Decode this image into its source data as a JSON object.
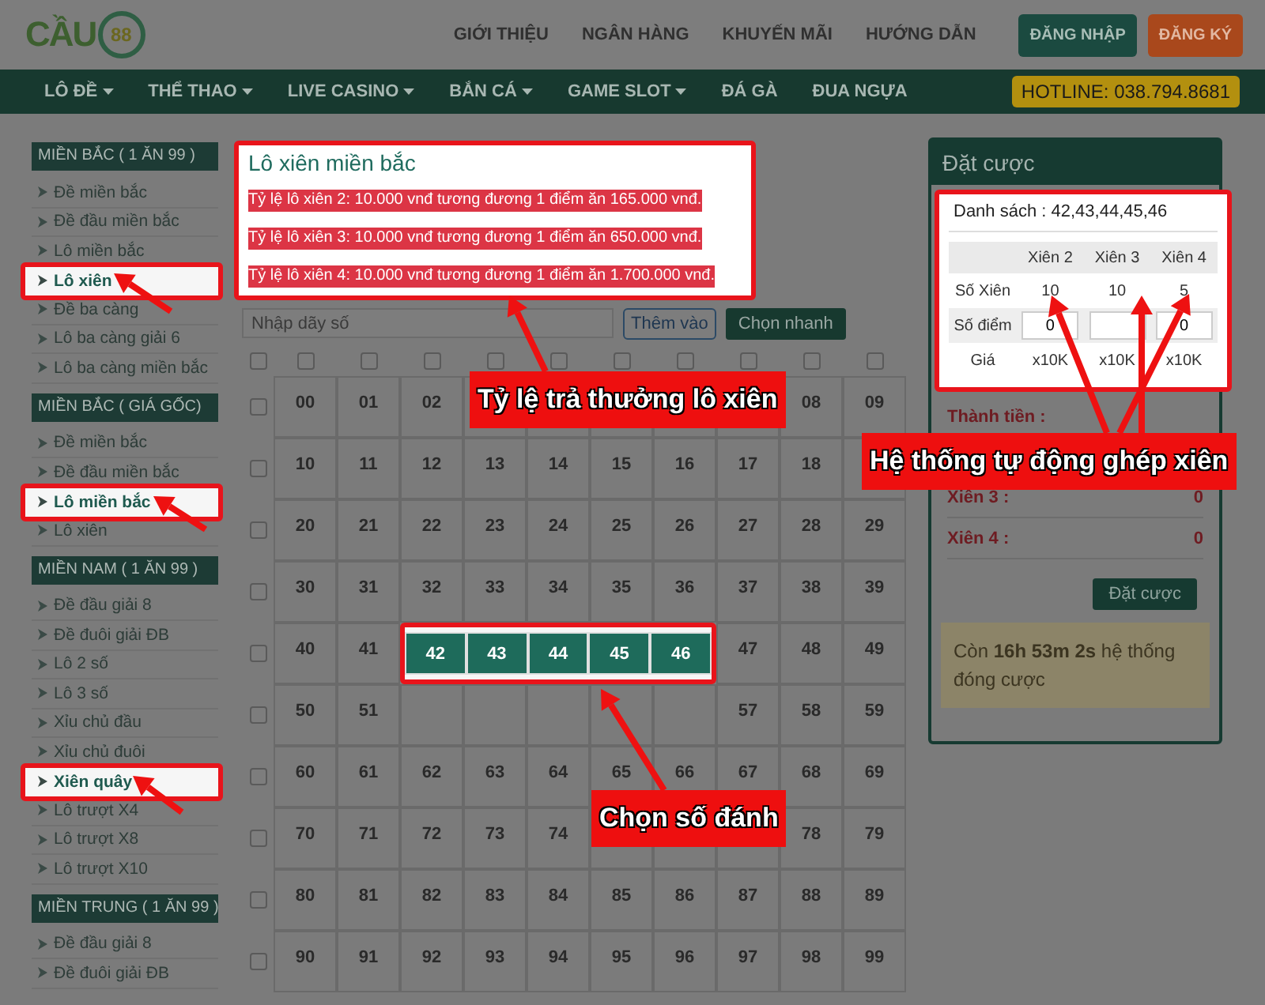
{
  "logo": {
    "text": "CẦU",
    "badge": "88"
  },
  "top_links": [
    "GIỚI THIỆU",
    "NGÂN HÀNG",
    "KHUYẾN MÃI",
    "HƯỚNG DẪN"
  ],
  "auth_buttons": [
    {
      "label": "ĐĂNG NHẬP",
      "kind": "login"
    },
    {
      "label": "ĐĂNG KÝ",
      "kind": "signup"
    }
  ],
  "nav": [
    {
      "label": "LÔ ĐỀ",
      "dropdown": true
    },
    {
      "label": "THỂ THAO",
      "dropdown": true
    },
    {
      "label": "LIVE CASINO",
      "dropdown": true
    },
    {
      "label": "BẮN CÁ",
      "dropdown": true
    },
    {
      "label": "GAME SLOT",
      "dropdown": true
    },
    {
      "label": "ĐÁ GÀ",
      "dropdown": false
    },
    {
      "label": "ĐUA NGỰA",
      "dropdown": false
    }
  ],
  "hotline": "HOTLINE: 038.794.8681",
  "sidebar": [
    {
      "title": "MIỀN BẮC ( 1 ĂN 99 )",
      "items": [
        {
          "label": "Đề miền bắc",
          "highlighted": false
        },
        {
          "label": "Đề đầu miền bắc",
          "highlighted": false
        },
        {
          "label": "Lô miền bắc",
          "highlighted": false
        },
        {
          "label": "Lô xiên",
          "highlighted": true
        },
        {
          "label": "Đề ba càng",
          "highlighted": false
        },
        {
          "label": "Lô ba càng giải 6",
          "highlighted": false
        },
        {
          "label": "Lô ba càng miền bắc",
          "highlighted": false
        }
      ]
    },
    {
      "title": "MIỀN BẮC ( GIÁ GỐC)",
      "items": [
        {
          "label": "Đề miền bắc",
          "highlighted": false
        },
        {
          "label": "Đề đầu miền bắc",
          "highlighted": false
        },
        {
          "label": "Lô miền bắc",
          "highlighted": true
        },
        {
          "label": "Lô xiên",
          "highlighted": false
        }
      ]
    },
    {
      "title": "MIỀN NAM ( 1 ĂN 99 )",
      "items": [
        {
          "label": "Đề đầu giải 8",
          "highlighted": false
        },
        {
          "label": "Đề đuôi giải ĐB",
          "highlighted": false
        },
        {
          "label": "Lô 2 số",
          "highlighted": false
        },
        {
          "label": "Lô 3 số",
          "highlighted": false
        },
        {
          "label": "Xỉu chủ đầu",
          "highlighted": false
        },
        {
          "label": "Xỉu chủ đuôi",
          "highlighted": false
        },
        {
          "label": "Xiên quây",
          "highlighted": true
        },
        {
          "label": "Lô trượt X4",
          "highlighted": false
        },
        {
          "label": "Lô trượt X8",
          "highlighted": false
        },
        {
          "label": "Lô trượt X10",
          "highlighted": false
        }
      ]
    },
    {
      "title": "MIỀN TRUNG ( 1 ĂN 99 )",
      "items": [
        {
          "label": "Đề đầu giải 8",
          "highlighted": false
        },
        {
          "label": "Đề đuôi giải ĐB",
          "highlighted": false
        }
      ]
    }
  ],
  "rates": {
    "title": "Lô xiên miền bắc",
    "lines": [
      "Tỷ lệ lô xiên 2: 10.000 vnđ tương đương 1 điểm ăn 165.000 vnđ.",
      "Tỷ lệ lô xiên 3: 10.000 vnđ tương đương 1 điểm ăn 650.000 vnđ.",
      "Tỷ lệ lô xiên 4: 10.000 vnđ tương đương 1 điểm ăn 1.700.000 vnđ."
    ]
  },
  "number_input": {
    "placeholder": "Nhập dãy số"
  },
  "add_button": "Thêm vào",
  "quick_button": "Chọn nhanh",
  "grid": {
    "column_checks": [
      {
        "checked": false
      },
      {
        "checked": false
      },
      {
        "checked": false
      },
      {
        "checked": false
      },
      {
        "checked": false
      },
      {
        "checked": false
      },
      {
        "checked": false
      },
      {
        "checked": false
      },
      {
        "checked": false
      },
      {
        "checked": false
      },
      {
        "checked": false
      }
    ],
    "rows": [
      {
        "checked": false,
        "cells": [
          {
            "label": "00",
            "selected": false
          },
          {
            "label": "01",
            "selected": false
          },
          {
            "label": "02",
            "selected": false
          },
          {
            "selected": false
          },
          {
            "selected": false
          },
          {
            "selected": false
          },
          {
            "selected": false
          },
          {
            "selected": false
          },
          {
            "label": "08",
            "selected": false
          },
          {
            "label": "09",
            "selected": false
          }
        ]
      },
      {
        "checked": false,
        "cells": [
          {
            "label": "10",
            "selected": false
          },
          {
            "label": "11",
            "selected": false
          },
          {
            "label": "12",
            "selected": false
          },
          {
            "label": "13",
            "selected": false
          },
          {
            "label": "14",
            "selected": false
          },
          {
            "label": "15",
            "selected": false
          },
          {
            "label": "16",
            "selected": false
          },
          {
            "label": "17",
            "selected": false
          },
          {
            "label": "18",
            "selected": false
          },
          {
            "selected": false
          }
        ]
      },
      {
        "checked": false,
        "cells": [
          {
            "label": "20",
            "selected": false
          },
          {
            "label": "21",
            "selected": false
          },
          {
            "label": "22",
            "selected": false
          },
          {
            "label": "23",
            "selected": false
          },
          {
            "label": "24",
            "selected": false
          },
          {
            "label": "25",
            "selected": false
          },
          {
            "label": "26",
            "selected": false
          },
          {
            "label": "27",
            "selected": false
          },
          {
            "label": "28",
            "selected": false
          },
          {
            "label": "29",
            "selected": false
          }
        ]
      },
      {
        "checked": false,
        "cells": [
          {
            "label": "30",
            "selected": false
          },
          {
            "label": "31",
            "selected": false
          },
          {
            "label": "32",
            "selected": false
          },
          {
            "label": "33",
            "selected": false
          },
          {
            "label": "34",
            "selected": false
          },
          {
            "label": "35",
            "selected": false
          },
          {
            "label": "36",
            "selected": false
          },
          {
            "label": "37",
            "selected": false
          },
          {
            "label": "38",
            "selected": false
          },
          {
            "label": "39",
            "selected": false
          }
        ]
      },
      {
        "checked": false,
        "cells": [
          {
            "label": "40",
            "selected": false
          },
          {
            "label": "41",
            "selected": false
          },
          {
            "label": "42",
            "selected": true
          },
          {
            "label": "43",
            "selected": true
          },
          {
            "label": "44",
            "selected": true
          },
          {
            "label": "45",
            "selected": true
          },
          {
            "label": "46",
            "selected": true
          },
          {
            "label": "47",
            "selected": false
          },
          {
            "label": "48",
            "selected": false
          },
          {
            "label": "49",
            "selected": false
          }
        ]
      },
      {
        "checked": false,
        "cells": [
          {
            "label": "50",
            "selected": false
          },
          {
            "label": "51",
            "selected": false
          },
          {
            "selected": false
          },
          {
            "selected": false
          },
          {
            "selected": false
          },
          {
            "selected": false
          },
          {
            "selected": false
          },
          {
            "label": "57",
            "selected": false
          },
          {
            "label": "58",
            "selected": false
          },
          {
            "label": "59",
            "selected": false
          }
        ]
      },
      {
        "checked": false,
        "cells": [
          {
            "label": "60",
            "selected": false
          },
          {
            "label": "61",
            "selected": false
          },
          {
            "label": "62",
            "selected": false
          },
          {
            "label": "63",
            "selected": false
          },
          {
            "label": "64",
            "selected": false
          },
          {
            "label": "65",
            "selected": false
          },
          {
            "label": "66",
            "selected": false
          },
          {
            "label": "67",
            "selected": false
          },
          {
            "label": "68",
            "selected": false
          },
          {
            "label": "69",
            "selected": false
          }
        ]
      },
      {
        "checked": false,
        "cells": [
          {
            "label": "70",
            "selected": false
          },
          {
            "label": "71",
            "selected": false
          },
          {
            "label": "72",
            "selected": false
          },
          {
            "label": "73",
            "selected": false
          },
          {
            "label": "74",
            "selected": false
          },
          {
            "selected": false
          },
          {
            "selected": false
          },
          {
            "selected": false
          },
          {
            "label": "78",
            "selected": false
          },
          {
            "label": "79",
            "selected": false
          }
        ]
      },
      {
        "checked": false,
        "cells": [
          {
            "label": "80",
            "selected": false
          },
          {
            "label": "81",
            "selected": false
          },
          {
            "label": "82",
            "selected": false
          },
          {
            "label": "83",
            "selected": false
          },
          {
            "label": "84",
            "selected": false
          },
          {
            "label": "85",
            "selected": false
          },
          {
            "label": "86",
            "selected": false
          },
          {
            "label": "87",
            "selected": false
          },
          {
            "label": "88",
            "selected": false
          },
          {
            "label": "89",
            "selected": false
          }
        ]
      },
      {
        "checked": false,
        "cells": [
          {
            "label": "90",
            "selected": false
          },
          {
            "label": "91",
            "selected": false
          },
          {
            "label": "92",
            "selected": false
          },
          {
            "label": "93",
            "selected": false
          },
          {
            "label": "94",
            "selected": false
          },
          {
            "label": "95",
            "selected": false
          },
          {
            "label": "96",
            "selected": false
          },
          {
            "label": "97",
            "selected": false
          },
          {
            "label": "98",
            "selected": false
          },
          {
            "label": "99",
            "selected": false
          }
        ]
      }
    ]
  },
  "bet_panel": {
    "title": "Đặt cược",
    "list": "Danh sách : 42,43,44,45,46",
    "table": {
      "columns": [
        "Xiên 2",
        "Xiên 3",
        "Xiên 4"
      ],
      "rows": [
        {
          "label": "Số Xiên",
          "kind": "text",
          "cells": [
            {
              "text": "10"
            },
            {
              "text": "10"
            },
            {
              "text": "5"
            }
          ]
        },
        {
          "label": "Số điểm",
          "kind": "input",
          "cells": [
            {
              "value": "0"
            },
            {},
            {
              "value": "0"
            }
          ]
        },
        {
          "label": "Giá",
          "kind": "text",
          "cells": [
            {
              "text": "x10K"
            },
            {
              "text": "x10K"
            },
            {
              "text": "x10K"
            }
          ]
        }
      ]
    },
    "totals": [
      {
        "label": "Thành tiền :"
      },
      {
        "label": "Xiên 3 :",
        "value": "0"
      },
      {
        "label": "Xiên 4 :",
        "value": "0"
      }
    ],
    "button": "Đặt cược",
    "notice": "Còn **16h 53m 2s** hệ thống đóng cược"
  },
  "callouts": [
    {
      "text": "Tỷ lệ trả thưởng lô xiên"
    },
    {
      "text": "Hệ thống tự động ghép xiên"
    },
    {
      "text": "Chọn số đánh"
    }
  ]
}
